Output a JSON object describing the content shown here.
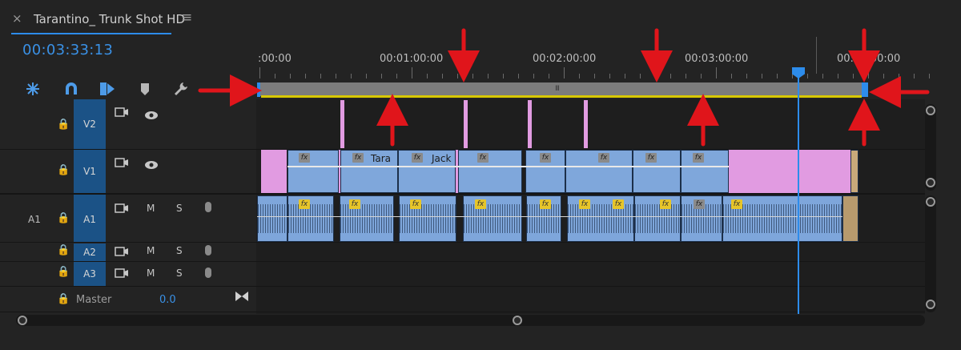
{
  "panel": {
    "close_glyph": "×",
    "sequence_title": "Tarantino_ Trunk Shot HD",
    "menu_glyph": "≡",
    "timecode": "00:03:33:13"
  },
  "ruler": {
    "labels": [
      ":00:00",
      "00:01:00:00",
      "00:02:00:00",
      "00:03:00:00",
      "00:04:00:00"
    ]
  },
  "tools": [
    {
      "name": "snap-icon",
      "glyph": "✳",
      "color": "#4d9be8"
    },
    {
      "name": "linked-selection-icon",
      "glyph": "∩",
      "color": "#4d9be8"
    },
    {
      "name": "add-marker-icon",
      "glyph": "◆",
      "color": "#4d9be8"
    },
    {
      "name": "marker-icon",
      "glyph": "⬟",
      "color": "#b8b8b8"
    },
    {
      "name": "wrench-icon",
      "glyph": "🔧",
      "color": "#b8b8b8"
    }
  ],
  "workarea": {
    "grip": "III"
  },
  "tracks": {
    "V2": {
      "label": "V2"
    },
    "V1": {
      "label": "V1"
    },
    "A1": {
      "label": "A1",
      "source_label": "A1"
    },
    "A2": {
      "label": "A2"
    },
    "A3": {
      "label": "A3"
    },
    "master": {
      "label": "Master",
      "value": "0.0"
    },
    "mute": "M",
    "solo": "S"
  },
  "clips": {
    "v1_labels": [
      "Tara",
      "Jack"
    ],
    "fx": "fx"
  },
  "colors": {
    "accent": "#2d8ceb",
    "video_clip": "#7fa7db",
    "pink_clip": "#e19be1",
    "annotation": "#e0151b",
    "workarea_yellow": "#d8c800"
  }
}
